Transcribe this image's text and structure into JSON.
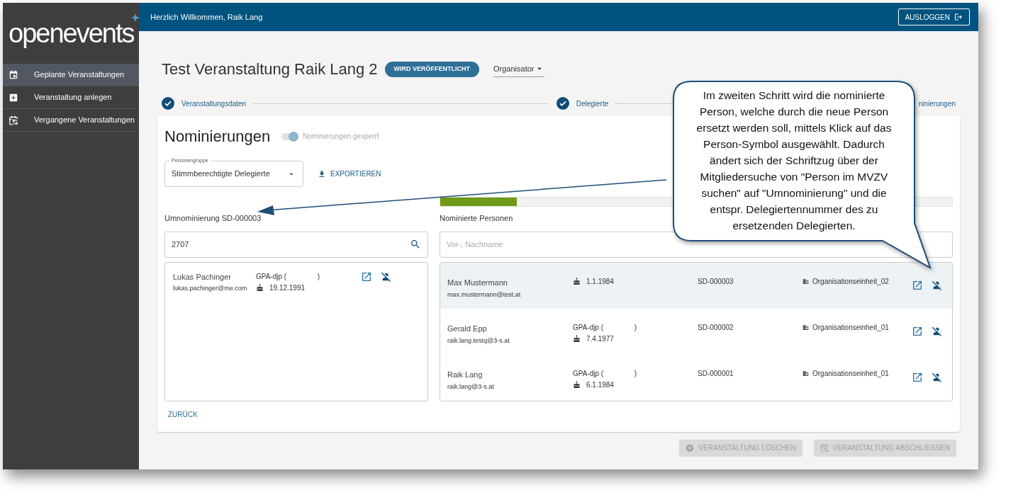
{
  "logo": {
    "text": "openevents"
  },
  "sidebar": {
    "items": [
      {
        "label": "Geplante Veranstaltungen",
        "kind": "calendar",
        "selected": true
      },
      {
        "label": "Veranstaltung anlegen",
        "kind": "add",
        "selected": false
      },
      {
        "label": "Vergangene Veranstaltungen",
        "kind": "history",
        "selected": false
      }
    ]
  },
  "header": {
    "greeting": "Herzlich Willkommen, Raik Lang",
    "logout": "AUSLOGGEN"
  },
  "event": {
    "title": "Test Veranstaltung Raik Lang 2",
    "status": "WIRD VERÖFFENTLICHT",
    "role": "Organisator"
  },
  "steps": [
    {
      "label": "Veranstaltungsdaten",
      "done": true
    },
    {
      "label": "Delegierte",
      "done": true
    },
    {
      "label": "ninierungen"
    }
  ],
  "nominations": {
    "title": "Nominierungen",
    "lock_toggle": {
      "label": "Nominierungen gesperrt",
      "on": true
    },
    "group_select": {
      "label": "Personengruppe",
      "value": "Stimmberechtigte Delegierte"
    },
    "export": "EXPORTIEREN",
    "progress": {
      "level": 0.15
    },
    "left": {
      "label": "Umnominierung SD-000003",
      "search_value": "2707",
      "results": [
        {
          "name": "Lukas Pachinger",
          "email": "lukas.pachinger@me.com",
          "party_open": "GPA-djp (",
          "party_close": ")",
          "birthdate": "19.12.1991"
        }
      ],
      "back": "ZURÜCK"
    },
    "right": {
      "label": "Nominierte Personen",
      "search_placeholder": "Vor-, Nachname",
      "rows": [
        {
          "name": "Max Mustermann",
          "email": "max.mustermann@test.at",
          "birthdate": "1.1.1984",
          "number": "SD-000003",
          "unit": "Organisationseinheit_02",
          "selected": true
        },
        {
          "name": "Gerald Epp",
          "email": "raik.lang.testq@3-s.at",
          "party_open": "GPA-djp (",
          "party_close": ")",
          "birthdate": "7.4.1977",
          "number": "SD-000002",
          "unit": "Organisationseinheit_01",
          "selected": false
        },
        {
          "name": "Raik Lang",
          "email": "raik.lang@3-s.at",
          "party_open": "GPA-djp (",
          "party_close": ")",
          "birthdate": "6.1.1984",
          "number": "SD-000001",
          "unit": "Organisationseinheit_01",
          "selected": false
        }
      ]
    }
  },
  "actions": [
    {
      "label": "VERANSTALTUNG LÖSCHEN",
      "kind": "cancel",
      "disabled": true
    },
    {
      "label": "VERANSTALTUNG ABSCHLIESSEN",
      "kind": "history",
      "disabled": true
    }
  ],
  "callout": {
    "text": "Im zweiten Schritt wird die nominierte Person, welche durch die neue Person ersetzt werden soll, mittels Klick auf das Person-Symbol ausgewählt. Dadurch ändert sich der Schriftzug über der Mitgliedersuche von \"Person im MVZV suchen\" auf \"Umnominierung\" und die entspr. Delegiertennummer des zu ersetzenden Delegierten."
  }
}
